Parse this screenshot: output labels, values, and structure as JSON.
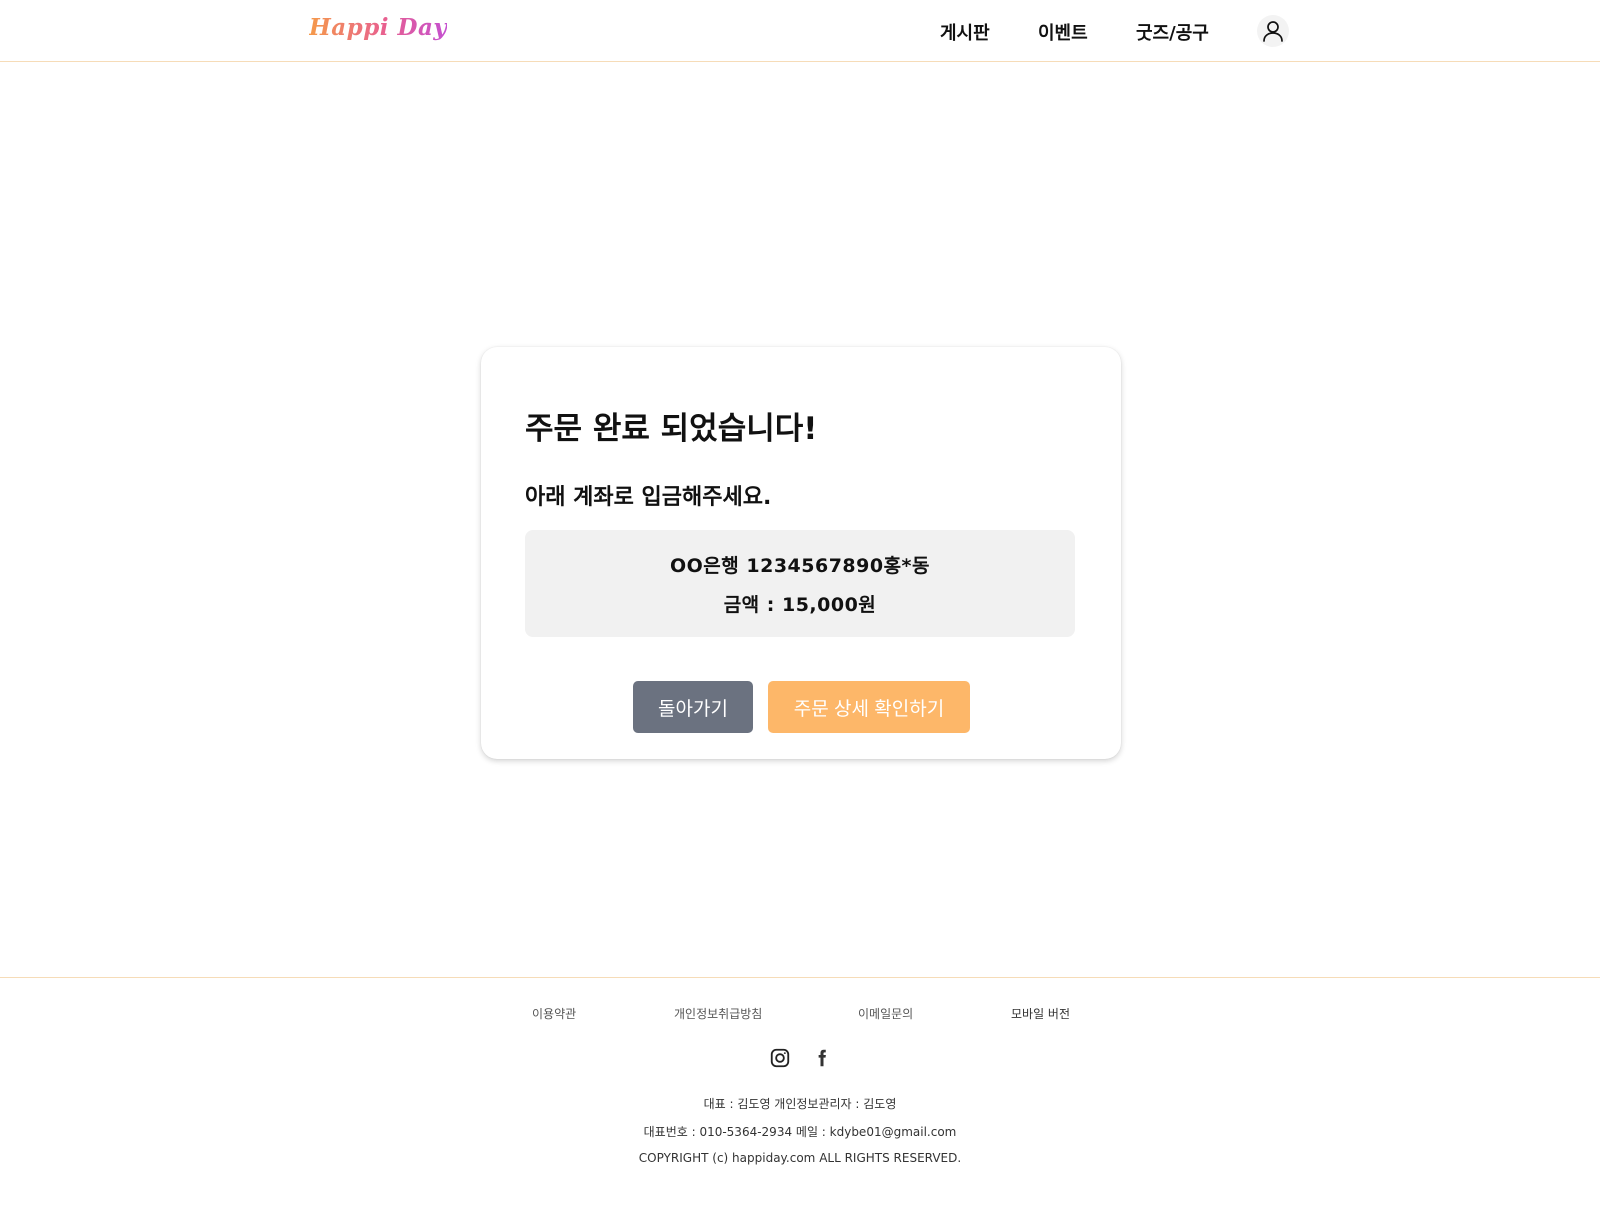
{
  "header": {
    "logo": "Happi Day",
    "nav": [
      "게시판",
      "이벤트",
      "굿즈/공구"
    ],
    "user_icon": "user-icon"
  },
  "card": {
    "title": "주문 완료 되었습니다!",
    "subtitle": "아래 계좌로 입금해주세요.",
    "account": "OO은행 1234567890홍*동",
    "amount": "금액 : 15,000원",
    "back_button": "돌아가기",
    "detail_button": "주문 상세 확인하기"
  },
  "footer": {
    "links": [
      "이용약관",
      "개인정보취급방침",
      "이메일문의",
      "모바일 버전"
    ],
    "social_icons": [
      "instagram-icon",
      "facebook-icon"
    ],
    "info_line1": "대표 : 김도영  개인정보관리자 : 김도영",
    "info_line2": "대표번호 : 010-5364-2934 메일 : kdybe01@gmail.com",
    "copyright": "COPYRIGHT (c) happiday.com ALL RIGHTS RESERVED."
  },
  "colors": {
    "accent": "#fdb769",
    "secondary_button": "#6b7280",
    "divider": "#f6dcb8",
    "account_box": "#f1f1f1"
  }
}
